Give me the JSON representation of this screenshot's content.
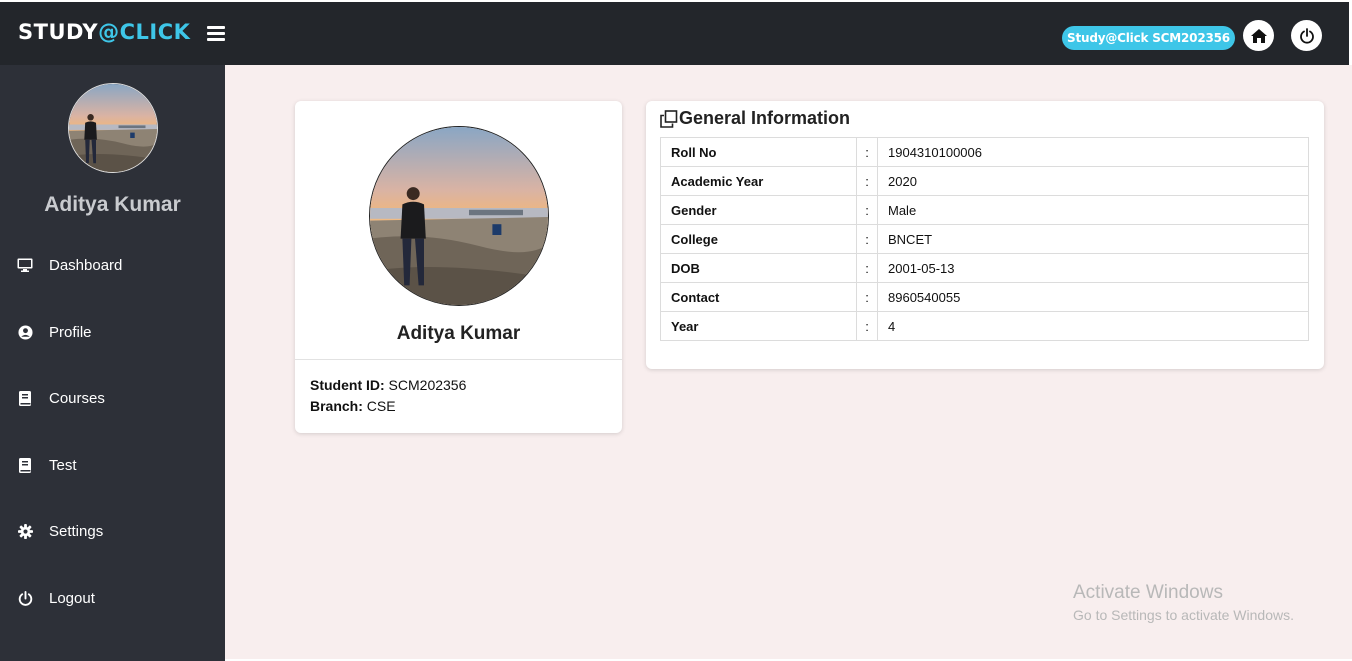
{
  "brand": {
    "part1": "STUDY",
    "part2": "@CLICK"
  },
  "topbar": {
    "id_badge": "Study@Click SCM202356",
    "home_icon": "home-icon",
    "power_icon": "power-icon"
  },
  "sidebar": {
    "user_name": "Aditya Kumar",
    "items": [
      {
        "label": "Dashboard",
        "icon": "monitor-icon"
      },
      {
        "label": "Profile",
        "icon": "user-circle-icon"
      },
      {
        "label": "Courses",
        "icon": "book-icon"
      },
      {
        "label": "Test",
        "icon": "book-icon"
      },
      {
        "label": "Settings",
        "icon": "gear-icon"
      },
      {
        "label": "Logout",
        "icon": "power-icon"
      }
    ]
  },
  "profile_card": {
    "name": "Aditya Kumar",
    "student_id_label": "Student ID:",
    "student_id": "SCM202356",
    "branch_label": "Branch:",
    "branch": "CSE"
  },
  "general_info": {
    "title": "General Information",
    "rows": [
      {
        "label": "Roll No",
        "sep": ":",
        "value": "1904310100006"
      },
      {
        "label": "Academic Year",
        "sep": ":",
        "value": "2020"
      },
      {
        "label": "Gender",
        "sep": ":",
        "value": "Male"
      },
      {
        "label": "College",
        "sep": ":",
        "value": "BNCET"
      },
      {
        "label": "DOB",
        "sep": ":",
        "value": "2001-05-13"
      },
      {
        "label": "Contact",
        "sep": ":",
        "value": "8960540055"
      },
      {
        "label": "Year",
        "sep": ":",
        "value": "4"
      }
    ]
  },
  "watermark": {
    "line1": "Activate Windows",
    "line2": "Go to Settings to activate Windows."
  },
  "colors": {
    "topbar": "#23262b",
    "sidebar": "#2d3038",
    "accent": "#3ec6e8",
    "main_bg": "#f8eeee"
  }
}
